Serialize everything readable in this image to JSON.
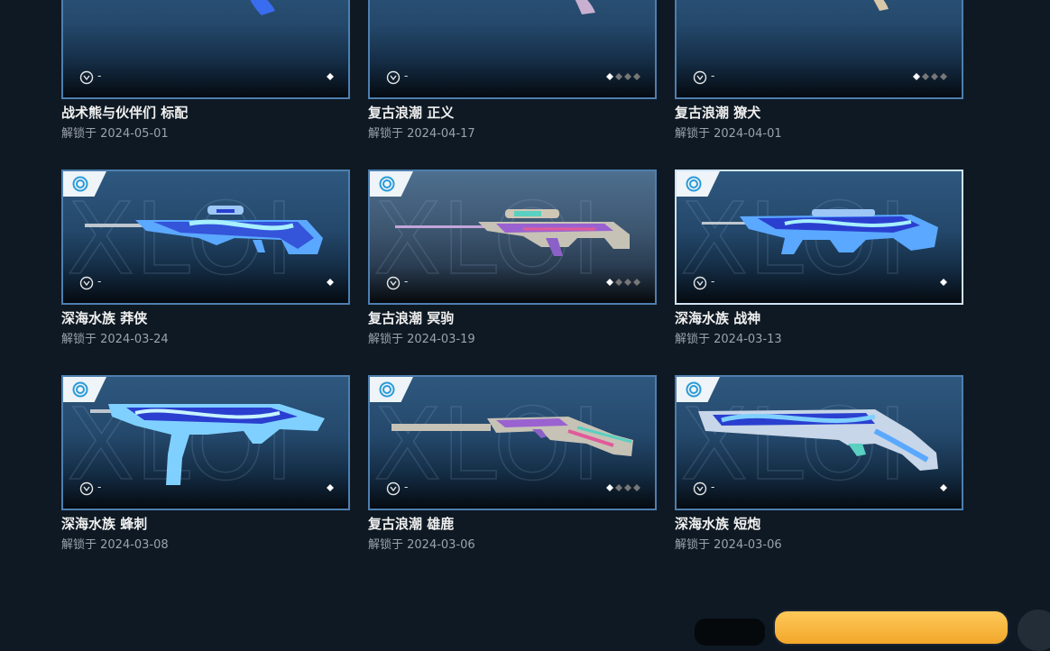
{
  "colors": {
    "background": "#0f1923",
    "card_border": "#4d7fb0",
    "card_border_selected": "#cfe3f5",
    "title_text": "#f0f0f0",
    "date_text": "#9aa3ad",
    "footer_button_accent": "#f2a72a"
  },
  "skins": [
    {
      "title": "战术熊与伙伴们 标配",
      "date": "解锁于 2024-05-01",
      "lock_text": "-",
      "level_count": 1,
      "tier_icon": "tier-icon",
      "weapon_icon": "weapon-image"
    },
    {
      "title": "复古浪潮 正义",
      "date": "解锁于 2024-04-17",
      "lock_text": "-",
      "level_count": 4,
      "tier_icon": "tier-icon",
      "weapon_icon": "weapon-image"
    },
    {
      "title": "复古浪潮 獠犬",
      "date": "解锁于 2024-04-01",
      "lock_text": "-",
      "level_count": 4,
      "tier_icon": "tier-icon",
      "weapon_icon": "weapon-image"
    },
    {
      "title": "深海水族 莽侠",
      "date": "解锁于 2024-03-24",
      "lock_text": "-",
      "level_count": 1,
      "tier_icon": "tier-icon",
      "weapon_icon": "sniper-rifle-icon"
    },
    {
      "title": "复古浪潮 冥驹",
      "date": "解锁于 2024-03-19",
      "lock_text": "-",
      "level_count": 4,
      "tier_icon": "tier-icon",
      "weapon_icon": "sniper-rifle-icon"
    },
    {
      "title": "深海水族 战神",
      "date": "解锁于 2024-03-13",
      "lock_text": "-",
      "level_count": 1,
      "tier_icon": "tier-icon",
      "weapon_icon": "machine-gun-icon"
    },
    {
      "title": "深海水族 蜂刺",
      "date": "解锁于 2024-03-08",
      "lock_text": "-",
      "level_count": 1,
      "tier_icon": "tier-icon",
      "weapon_icon": "smg-icon"
    },
    {
      "title": "复古浪潮 雄鹿",
      "date": "解锁于 2024-03-06",
      "lock_text": "-",
      "level_count": 4,
      "tier_icon": "tier-icon",
      "weapon_icon": "shotgun-icon"
    },
    {
      "title": "深海水族 短炮",
      "date": "解锁于 2024-03-06",
      "lock_text": "-",
      "level_count": 1,
      "tier_icon": "tier-icon",
      "weapon_icon": "sawed-off-shotgun-icon"
    }
  ],
  "footer": {
    "buttons": [
      "secondary-button",
      "primary-button",
      "round-button"
    ]
  }
}
